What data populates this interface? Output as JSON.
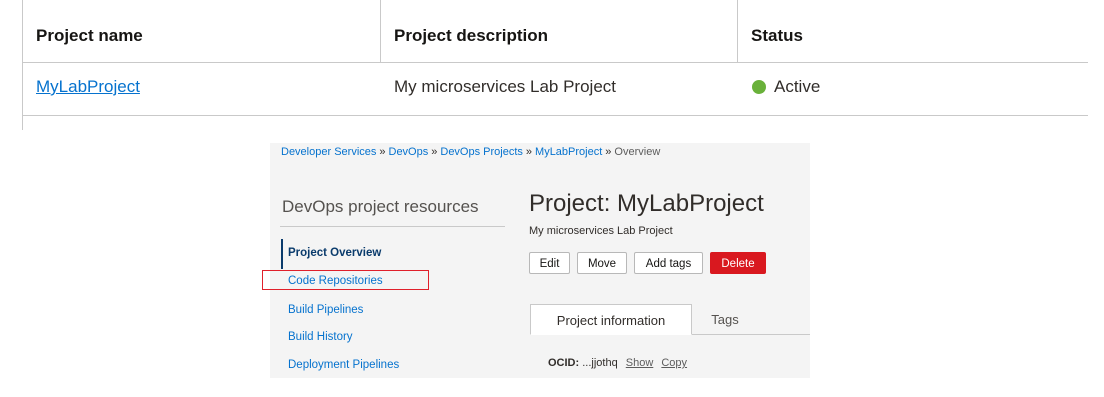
{
  "table": {
    "headers": [
      "Project name",
      "Project description",
      "Status"
    ],
    "rows": [
      {
        "name": "MyLabProject",
        "description": "My microservices Lab Project",
        "status": "Active",
        "status_color": "#69b13a"
      }
    ]
  },
  "console": {
    "breadcrumb": [
      "Developer Services",
      "DevOps",
      "DevOps Projects",
      "MyLabProject",
      "Overview"
    ],
    "breadcrumb_separator": "»",
    "sidebar": {
      "heading": "DevOps project resources",
      "items": [
        {
          "label": "Project Overview",
          "active": true
        },
        {
          "label": "Code Repositories",
          "highlighted": true
        },
        {
          "label": "Build Pipelines"
        },
        {
          "label": "Build History"
        },
        {
          "label": "Deployment Pipelines"
        }
      ]
    },
    "title": "Project: MyLabProject",
    "subtitle": "My microservices Lab Project",
    "buttons": {
      "edit": "Edit",
      "move": "Move",
      "add_tags": "Add tags",
      "delete": "Delete"
    },
    "tabs": [
      "Project information",
      "Tags"
    ],
    "ocid": {
      "label": "OCID:",
      "value": "...jjothq",
      "show": "Show",
      "copy": "Copy"
    }
  },
  "colors": {
    "link": "#0572ce",
    "active_nav": "#0a3b6c",
    "danger": "#d9181f",
    "highlight_outline": "#e0202b",
    "status_active": "#69b13a"
  }
}
